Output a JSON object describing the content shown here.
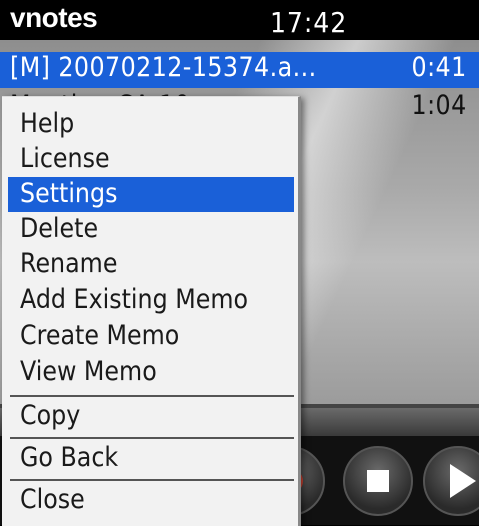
{
  "app": {
    "title": "vnotes",
    "clock": "17:42"
  },
  "recordings": [
    {
      "name": "[M] 20070212-15374.a...",
      "duration": "0:41",
      "selected": true
    },
    {
      "name": "Meeting CA-10",
      "duration": "1:04",
      "selected": false
    }
  ],
  "menu": {
    "items": [
      {
        "label": "Help"
      },
      {
        "label": "License"
      },
      {
        "label": "Settings",
        "highlighted": true
      },
      {
        "label": "Delete"
      },
      {
        "label": "Rename"
      },
      {
        "label": "Add Existing Memo"
      },
      {
        "label": "Create Memo"
      },
      {
        "label": "View Memo"
      }
    ],
    "after_sep1": "Copy",
    "after_sep2": "Go Back",
    "after_sep3": "Close"
  },
  "controls": {
    "icons": [
      "record-icon",
      "stop-icon",
      "play-icon"
    ]
  },
  "colors": {
    "selection": "#1a60d8",
    "menu_bg": "#f2f2f2",
    "status_bar_bg": "#000000"
  }
}
